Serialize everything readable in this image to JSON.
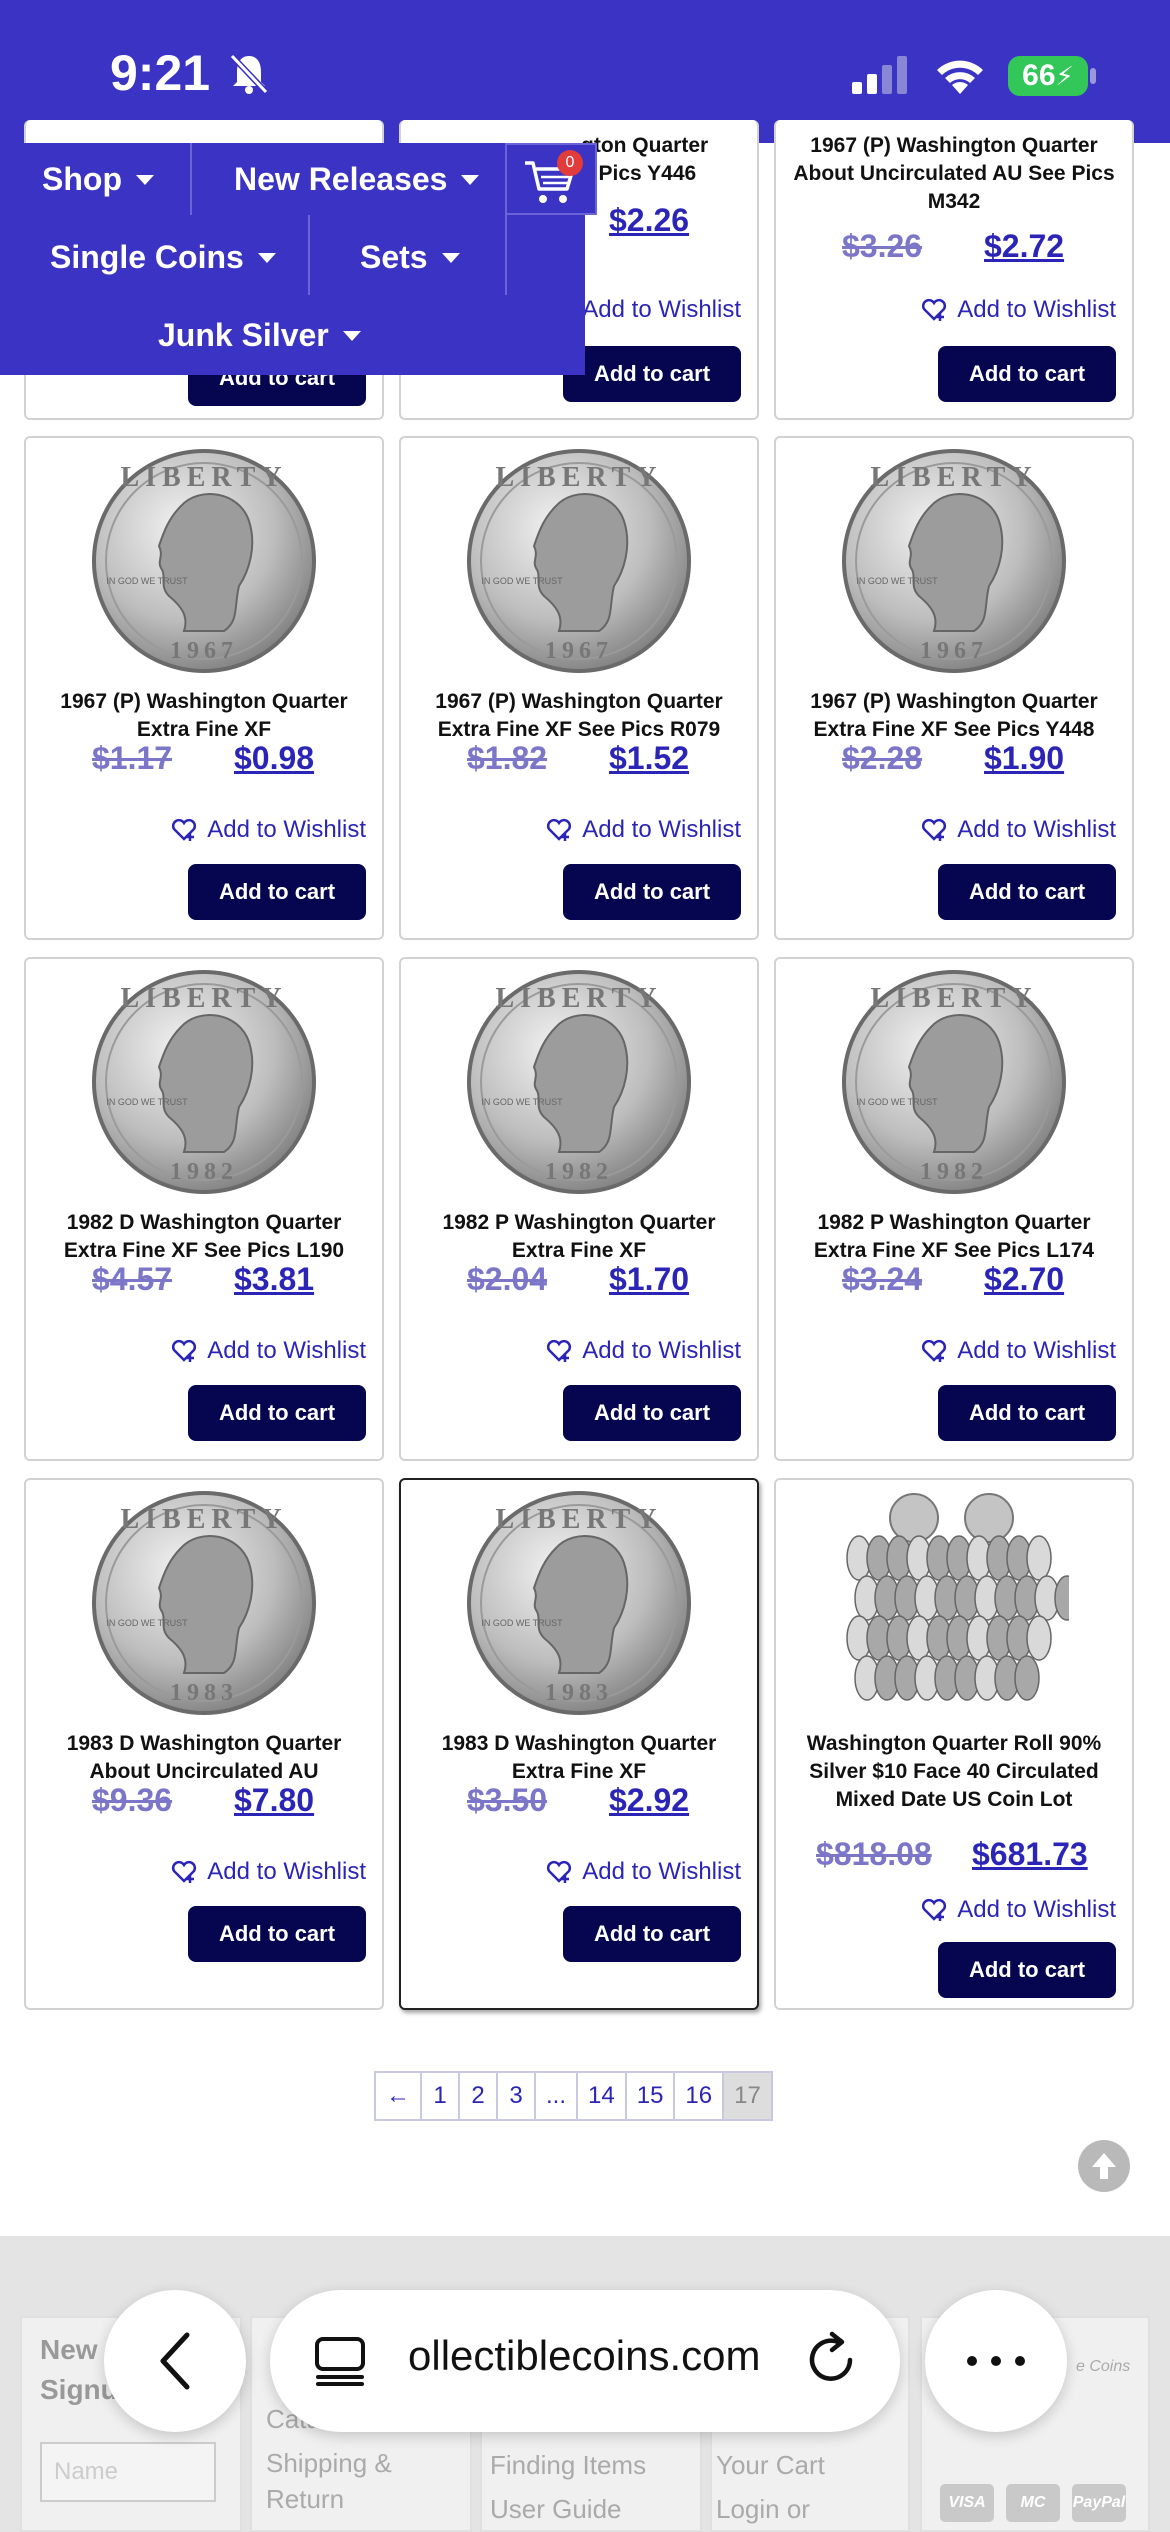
{
  "status_bar": {
    "time": "9:21",
    "battery": "66"
  },
  "nav": {
    "items": [
      {
        "label": "Shop"
      },
      {
        "label": "New Releases"
      },
      {
        "label": "Single Coins"
      },
      {
        "label": "Sets"
      },
      {
        "label": "Junk Silver"
      }
    ],
    "cart_count": "0"
  },
  "top_partial": {
    "col2_title": "gton Quarter",
    "col2_title2": "e Pics Y446",
    "col2_price": "$2.26",
    "col2_wishlist": "Add to Wishlist",
    "col2_add": "Add to cart",
    "col1_add": "Add to cart",
    "col3_title": "1967 (P) Washington Quarter About Uncirculated AU See Pics M342",
    "col3_old": "$3.26",
    "col3_new": "$2.72",
    "col3_wishlist": "Add to Wishlist",
    "col3_add": "Add to cart"
  },
  "products": [
    {
      "title": "1967 (P) Washington Quarter Extra Fine XF",
      "old_price": "$1.17",
      "new_price": "$0.98",
      "wishlist": "Add to Wishlist",
      "add": "Add to cart",
      "coin_year": "1967"
    },
    {
      "title": "1967 (P) Washington Quarter Extra Fine XF See Pics R079",
      "old_price": "$1.82",
      "new_price": "$1.52",
      "wishlist": "Add to Wishlist",
      "add": "Add to cart",
      "coin_year": "1967"
    },
    {
      "title": "1967 (P) Washington Quarter Extra Fine XF See Pics Y448",
      "old_price": "$2.28",
      "new_price": "$1.90",
      "wishlist": "Add to Wishlist",
      "add": "Add to cart",
      "coin_year": "1967"
    },
    {
      "title": "1982 D Washington Quarter Extra Fine XF See Pics L190",
      "old_price": "$4.57",
      "new_price": "$3.81",
      "wishlist": "Add to Wishlist",
      "add": "Add to cart",
      "coin_year": "1982"
    },
    {
      "title": "1982 P Washington Quarter Extra Fine XF",
      "old_price": "$2.04",
      "new_price": "$1.70",
      "wishlist": "Add to Wishlist",
      "add": "Add to cart",
      "coin_year": "1982"
    },
    {
      "title": "1982 P Washington Quarter Extra Fine XF See Pics L174",
      "old_price": "$3.24",
      "new_price": "$2.70",
      "wishlist": "Add to Wishlist",
      "add": "Add to cart",
      "coin_year": "1982"
    },
    {
      "title": "1983 D Washington Quarter About Uncirculated AU",
      "old_price": "$9.36",
      "new_price": "$7.80",
      "wishlist": "Add to Wishlist",
      "add": "Add to cart",
      "coin_year": "1983"
    },
    {
      "title": "1983 D Washington Quarter Extra Fine XF",
      "old_price": "$3.50",
      "new_price": "$2.92",
      "wishlist": "Add to Wishlist",
      "add": "Add to cart",
      "coin_year": "1983"
    },
    {
      "title": "Washington Quarter Roll 90% Silver $10 Face 40 Circulated Mixed Date US Coin Lot",
      "old_price": "$818.08",
      "new_price": "$681.73",
      "wishlist": "Add to Wishlist",
      "add": "Add to cart",
      "coin_year": ""
    }
  ],
  "coin_text": {
    "top": "LIBERTY",
    "motto": "IN GOD WE TRUST"
  },
  "pagination": {
    "prev": "←",
    "pages": [
      "1",
      "2",
      "3",
      "...",
      "14",
      "15",
      "16",
      "17"
    ],
    "current": "17"
  },
  "footer": {
    "col1_title": "New",
    "col1_title2": "Signu",
    "col1_input_placeholder": "Name",
    "col2_items": [
      "Catalo",
      "Shipping &",
      "Return"
    ],
    "col3_items": [
      "Finding Items",
      "User Guide"
    ],
    "col4_items": [
      "Your Cart",
      "Login or"
    ],
    "col5_brand": "e Coins",
    "pay": [
      "VISA",
      "MC",
      "PayPal"
    ]
  },
  "browser": {
    "url": "ollectiblecoins.com"
  }
}
